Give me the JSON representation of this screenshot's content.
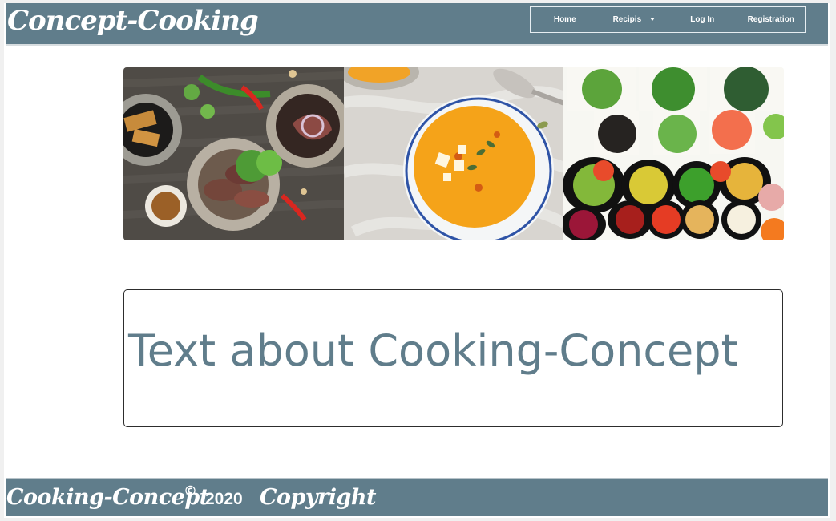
{
  "header": {
    "brand": "Concept-Cooking",
    "background_color": "#607d8b",
    "nav": [
      {
        "label": "Home"
      },
      {
        "label": "Recipis",
        "has_dropdown": true
      },
      {
        "label": "Log In"
      },
      {
        "label": "Registration"
      }
    ]
  },
  "gallery": {
    "images": [
      {
        "name": "grilled-meat-salad-photo",
        "description": "dark table with grilled meat salad plates"
      },
      {
        "name": "pumpkin-soup-photo",
        "description": "pumpkin soup bowl on light stone"
      },
      {
        "name": "vegetable-bowls-photo",
        "description": "colorful vegetable and salad bowls"
      }
    ]
  },
  "main": {
    "text_heading": "Text about Cooking-Concept",
    "accent_color": "#607d8b"
  },
  "footer": {
    "brand": "Cooking-Concept",
    "copyright_symbol": "©",
    "year": "2020",
    "copyright_label": "Copyright"
  }
}
